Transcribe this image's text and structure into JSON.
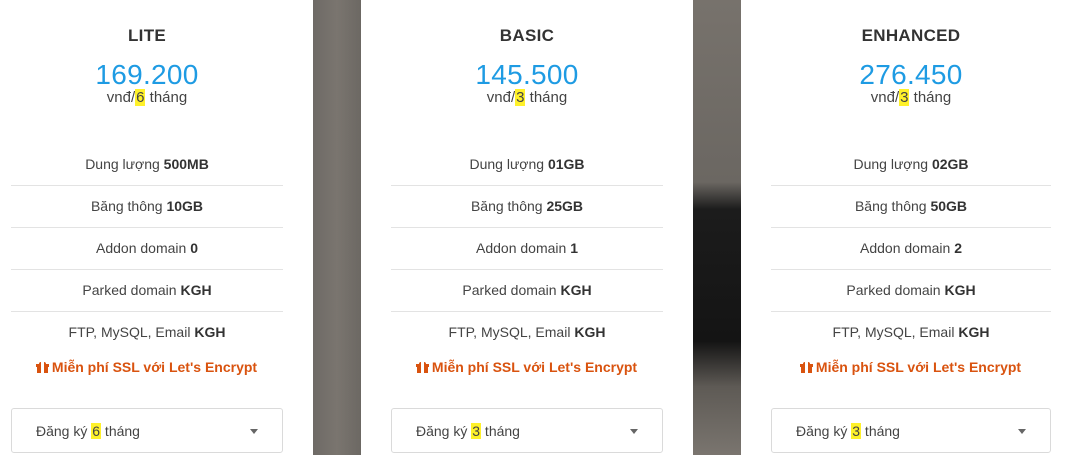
{
  "plans": [
    {
      "name": "LITE",
      "price": "169.200",
      "period_prefix": "vnđ/",
      "period_hl": "6",
      "period_suffix": " tháng",
      "features": [
        {
          "label": "Dung lượng ",
          "value": "500MB"
        },
        {
          "label": "Băng thông ",
          "value": "10GB"
        },
        {
          "label": "Addon domain ",
          "value": "0"
        },
        {
          "label": "Parked domain ",
          "value": "KGH"
        },
        {
          "label": "FTP, MySQL, Email ",
          "value": "KGH"
        }
      ],
      "ssl": "Miễn phí SSL với Let's Encrypt",
      "select_prefix": "Đăng ký ",
      "select_hl": "6",
      "select_suffix": " tháng"
    },
    {
      "name": "BASIC",
      "price": "145.500",
      "period_prefix": "vnđ/",
      "period_hl": "3",
      "period_suffix": " tháng",
      "features": [
        {
          "label": "Dung lượng ",
          "value": "01GB"
        },
        {
          "label": "Băng thông ",
          "value": "25GB"
        },
        {
          "label": "Addon domain ",
          "value": "1"
        },
        {
          "label": "Parked domain ",
          "value": "KGH"
        },
        {
          "label": "FTP, MySQL, Email ",
          "value": "KGH"
        }
      ],
      "ssl": "Miễn phí SSL với Let's Encrypt",
      "select_prefix": "Đăng ký ",
      "select_hl": "3",
      "select_suffix": " tháng"
    },
    {
      "name": "ENHANCED",
      "price": "276.450",
      "period_prefix": "vnđ/",
      "period_hl": "3",
      "period_suffix": " tháng",
      "features": [
        {
          "label": "Dung lượng ",
          "value": "02GB"
        },
        {
          "label": "Băng thông ",
          "value": "50GB"
        },
        {
          "label": "Addon domain ",
          "value": "2"
        },
        {
          "label": "Parked domain ",
          "value": "KGH"
        },
        {
          "label": "FTP, MySQL, Email ",
          "value": "KGH"
        }
      ],
      "ssl": "Miễn phí SSL với Let's Encrypt",
      "select_prefix": "Đăng ký ",
      "select_hl": "3",
      "select_suffix": " tháng"
    }
  ],
  "icons": {
    "ssl": "gift-icon",
    "select": "caret-down-icon"
  },
  "colors": {
    "price": "#1e9be3",
    "ssl": "#d9530f",
    "highlight": "#fff12a"
  }
}
